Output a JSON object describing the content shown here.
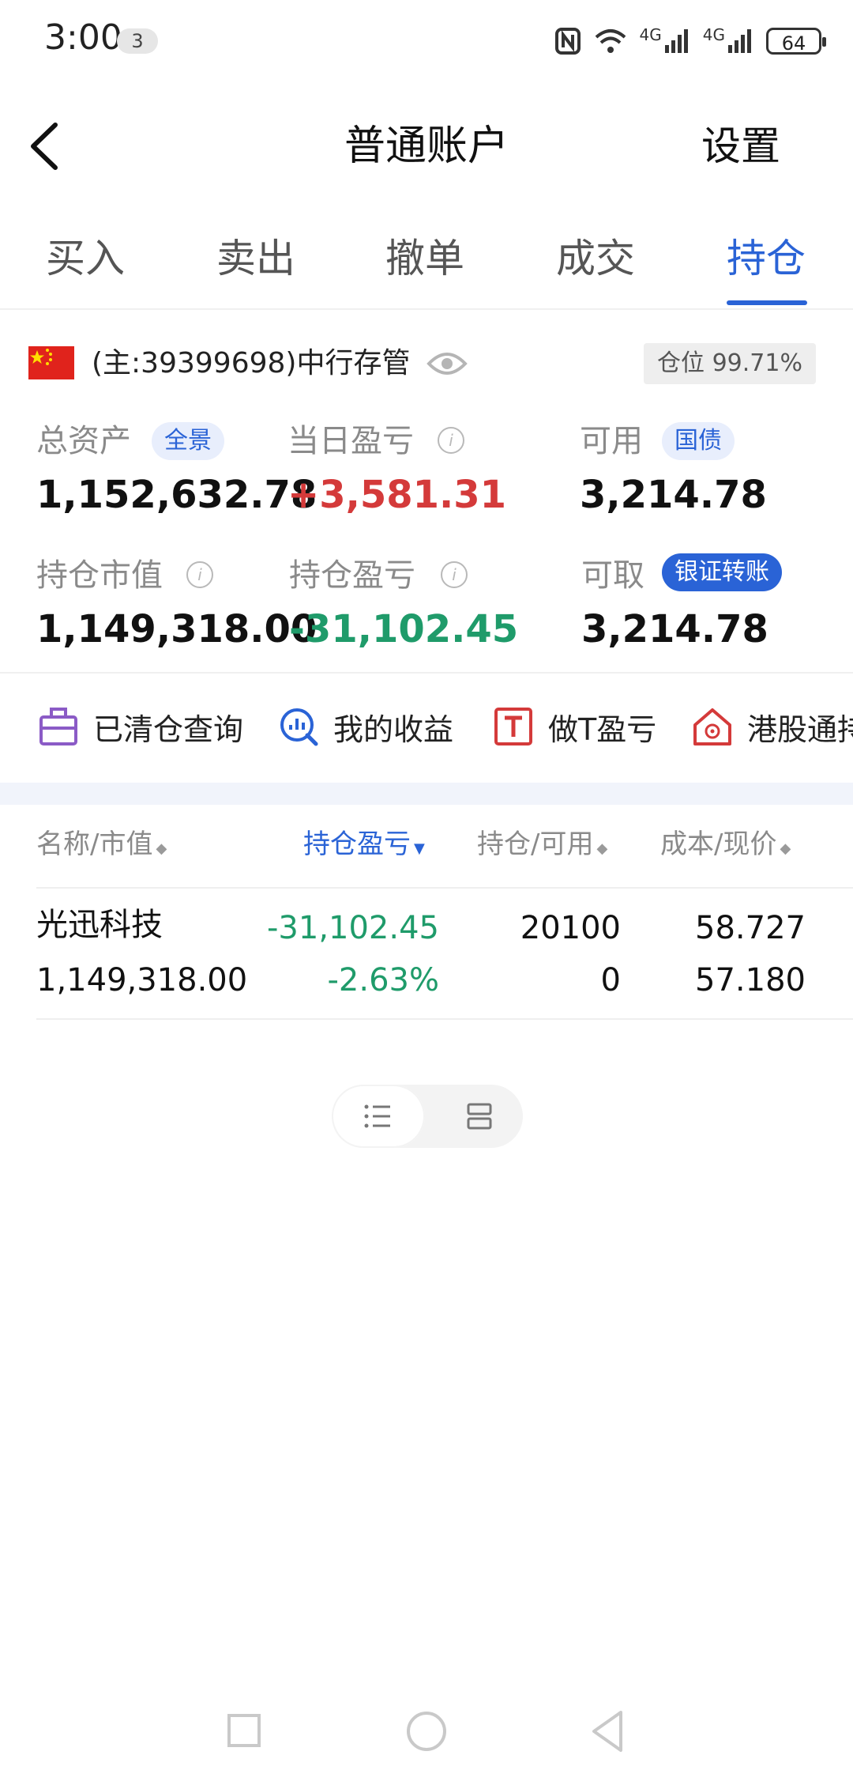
{
  "status_bar": {
    "time": "3:00",
    "notification_count": "3",
    "battery": "64",
    "network_1": "4G",
    "network_2": "4G"
  },
  "header": {
    "title": "普通账户",
    "settings_label": "设置"
  },
  "tabs": [
    {
      "label": "买入"
    },
    {
      "label": "卖出"
    },
    {
      "label": "撤单"
    },
    {
      "label": "成交"
    },
    {
      "label": "持仓",
      "active": true
    }
  ],
  "account": {
    "text": "(主:39399698)中行存管",
    "position_label": "仓位 99.71%"
  },
  "metrics": {
    "total_assets_label": "总资产",
    "total_assets_pill": "全景",
    "total_assets_value": "1,152,632.78",
    "daily_pl_label": "当日盈亏",
    "daily_pl_value": "+3,581.31",
    "available_label": "可用",
    "available_pill": "国债",
    "available_value": "3,214.78",
    "market_value_label": "持仓市值",
    "market_value_value": "1,149,318.00",
    "position_pl_label": "持仓盈亏",
    "position_pl_value": "-31,102.45",
    "withdrawable_label": "可取",
    "withdrawable_pill": "银证转账",
    "withdrawable_value": "3,214.78"
  },
  "quick_actions": [
    {
      "label": "已清仓查询",
      "icon": "briefcase-icon"
    },
    {
      "label": "我的收益",
      "icon": "chart-search-icon"
    },
    {
      "label": "做T盈亏",
      "icon": "t-box-icon"
    },
    {
      "label": "港股通持",
      "icon": "hk-house-icon"
    }
  ],
  "table": {
    "headers": [
      "名称/市值",
      "持仓盈亏",
      "持仓/可用",
      "成本/现价"
    ],
    "rows": [
      {
        "name": "光迅科技",
        "market_value": "1,149,318.00",
        "pl": "-31,102.45",
        "pl_pct": "-2.63%",
        "holding": "20100",
        "available": "0",
        "cost": "58.727",
        "price": "57.180"
      }
    ]
  },
  "colors": {
    "accent": "#2a63d6",
    "profit": "#d43a3a",
    "loss": "#1f9b6a"
  }
}
